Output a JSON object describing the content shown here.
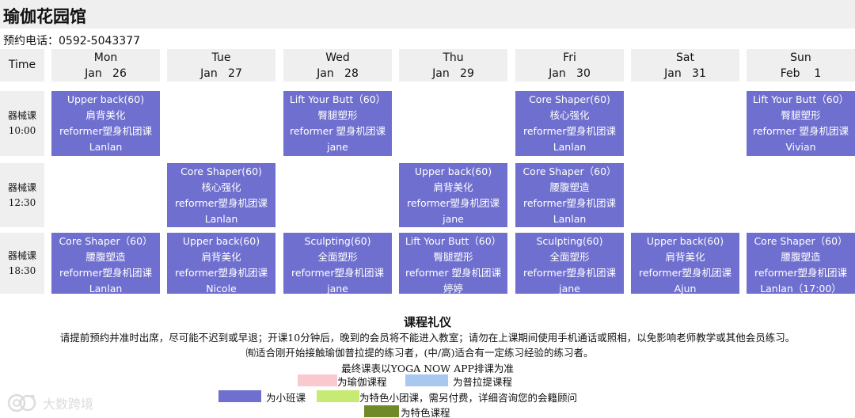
{
  "header": {
    "title": "瑜伽花园馆",
    "phone": "预约电话：0592-5043377"
  },
  "schedule": {
    "time_label": "Time",
    "days": [
      {
        "day": "Mon",
        "date": "Jan   26"
      },
      {
        "day": "Tue",
        "date": "Jan   27"
      },
      {
        "day": "Wed",
        "date": "Jan   28"
      },
      {
        "day": "Thu",
        "date": "Jan   29"
      },
      {
        "day": "Fri",
        "date": "Jan   30"
      },
      {
        "day": "Sat",
        "date": "Jan   31"
      },
      {
        "day": "Sun",
        "date": "Feb    1"
      }
    ],
    "rows": [
      {
        "category": "器械课",
        "time": "10:00"
      },
      {
        "category": "器械课",
        "time": "12:30"
      },
      {
        "category": "器械课",
        "time": "18:30"
      }
    ],
    "classes": [
      {
        "row": 0,
        "col": 0,
        "lines": [
          "Upper back(60)",
          "肩背美化",
          "reformer塑身机团课",
          "Lanlan"
        ]
      },
      {
        "row": 0,
        "col": 2,
        "lines": [
          "Lift Your Butt（60）",
          "臀腿塑形",
          "reformer 塑身机团课",
          "jane"
        ]
      },
      {
        "row": 0,
        "col": 4,
        "lines": [
          "Core Shaper(60)",
          "核心强化",
          "reformer塑身机团课",
          "Lanlan"
        ]
      },
      {
        "row": 0,
        "col": 6,
        "lines": [
          "Lift Your Butt（60）",
          "臀腿塑形",
          "reformer 塑身机团课",
          "Vivian"
        ]
      },
      {
        "row": 1,
        "col": 1,
        "lines": [
          "Core Shaper(60)",
          "核心强化",
          "reformer塑身机团课",
          "Lanlan"
        ]
      },
      {
        "row": 1,
        "col": 3,
        "lines": [
          "Upper back(60)",
          "肩背美化",
          "reformer塑身机团课",
          "jane"
        ]
      },
      {
        "row": 1,
        "col": 4,
        "lines": [
          "Core Shaper（60）",
          "腰腹塑造",
          "reformer塑身机团课",
          "Lanlan"
        ]
      },
      {
        "row": 2,
        "col": 0,
        "lines": [
          "Core Shaper（60）",
          "腰腹塑造",
          "reformer塑身机团课",
          "Lanlan"
        ]
      },
      {
        "row": 2,
        "col": 1,
        "lines": [
          "Upper back(60)",
          "肩背美化",
          "reformer塑身机团课",
          "Nicole"
        ]
      },
      {
        "row": 2,
        "col": 2,
        "lines": [
          "Sculpting(60)",
          "全面塑形",
          "reformer塑身机团课",
          "jane"
        ]
      },
      {
        "row": 2,
        "col": 3,
        "lines": [
          "Lift Your Butt（60）",
          "臀腿塑形",
          "reformer 塑身机团课",
          "婷婷"
        ]
      },
      {
        "row": 2,
        "col": 4,
        "lines": [
          "Sculpting(60)",
          "全面塑形",
          "reformer塑身机团课",
          "jane"
        ]
      },
      {
        "row": 2,
        "col": 5,
        "lines": [
          "Upper back(60)",
          "肩背美化",
          "reformer塑身机团课",
          "Ajun"
        ]
      },
      {
        "row": 2,
        "col": 6,
        "lines": [
          "Core Shaper（60）",
          "腰腹塑造",
          "reformer塑身机团课",
          "Lanlan（17:00）"
        ]
      }
    ]
  },
  "rules": {
    "title": "课程礼仪",
    "line1": "请提前预约并准时出席，尽可能不迟到或早退；开课10分钟后，晚到的会员将不能进入教室；请勿在上课期间使用手机通话或照相，以免影响老师教学或其他会员练习。",
    "line2": "㈲适合刚开始接触瑜伽普拉提的练习者，(中/高)适合有一定练习经验的练习者。",
    "line3": "最终课表以YOGA NOW APP排课为准"
  },
  "legend": [
    {
      "label": "为瑜伽课程",
      "color": "#f9c9cf"
    },
    {
      "label": "为普拉提课程",
      "color": "#a9c8f0"
    },
    {
      "label": "为小班课",
      "color": "#6f6fcf"
    },
    {
      "label": "为特色小团课，需另付费，详细咨询您的会籍顾问",
      "color": "#c6ea74"
    },
    {
      "label": "为特色课程",
      "color": "#6f8a27"
    }
  ],
  "watermark": {
    "text": "大数跨境",
    "icon": "camera-logo-icon"
  },
  "colors": {
    "class_block": "#6f6fcf",
    "header_bg": "#efefef"
  }
}
